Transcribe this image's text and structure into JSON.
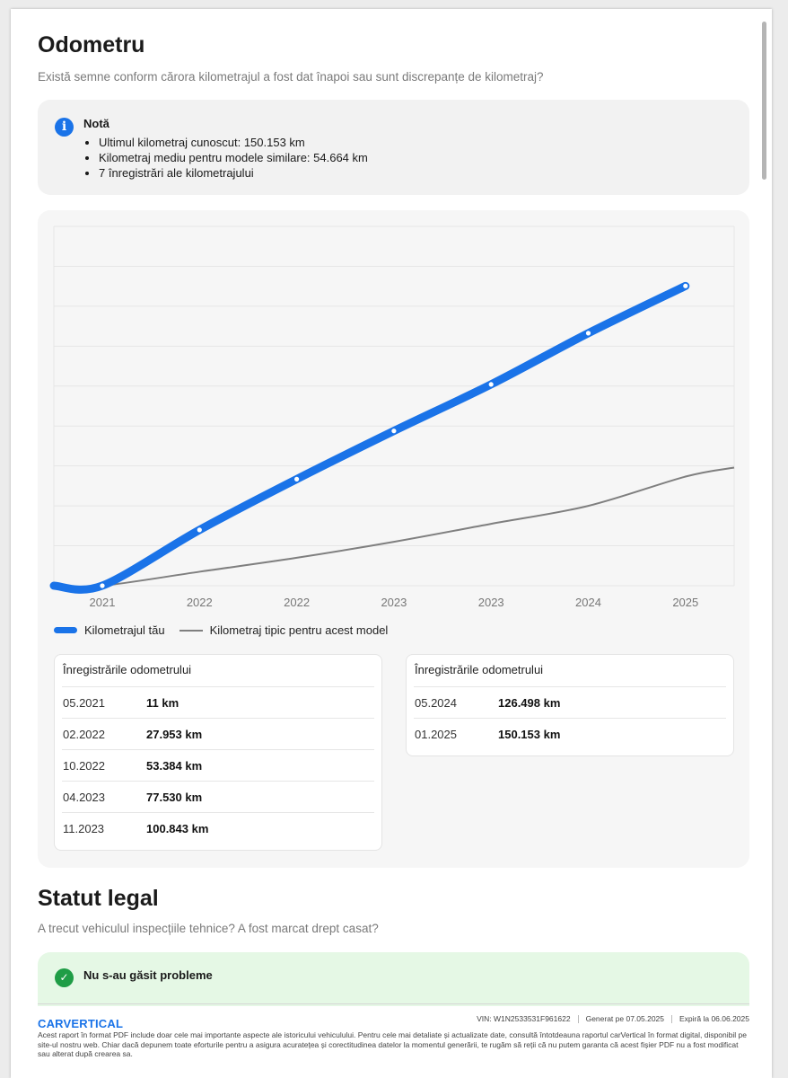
{
  "odometer": {
    "title": "Odometru",
    "subtitle": "Există semne conform cărora kilometrajul a fost dat înapoi sau sunt discrepanțe de kilometraj?",
    "note": {
      "icon": "info-icon",
      "title": "Notă",
      "items": [
        "Ultimul kilometraj cunoscut: 150.153 km",
        "Kilometraj mediu pentru modele similare: 54.664 km",
        "7 înregistrări ale kilometrajului"
      ]
    },
    "legend": {
      "yours": "Kilometrajul tău",
      "typical": "Kilometraj tipic pentru acest model"
    },
    "records_title": "Înregistrările odometrului",
    "records_left": [
      {
        "date": "05.2021",
        "value": "11 km"
      },
      {
        "date": "02.2022",
        "value": "27.953 km"
      },
      {
        "date": "10.2022",
        "value": "53.384 km"
      },
      {
        "date": "04.2023",
        "value": "77.530 km"
      },
      {
        "date": "11.2023",
        "value": "100.843 km"
      }
    ],
    "records_right": [
      {
        "date": "05.2024",
        "value": "126.498 km"
      },
      {
        "date": "01.2025",
        "value": "150.153 km"
      }
    ]
  },
  "chart_data": {
    "type": "line",
    "categories": [
      "2021",
      "2022",
      "2022",
      "2023",
      "2023",
      "2024",
      "2025"
    ],
    "ylim": [
      0,
      180000
    ],
    "grid": true,
    "legend_position": "bottom-left",
    "series": [
      {
        "name": "Kilometrajul tău",
        "color": "#1a73e8",
        "points": [
          {
            "label": "05.2021",
            "value": 11
          },
          {
            "label": "02.2022",
            "value": 27953
          },
          {
            "label": "10.2022",
            "value": 53384
          },
          {
            "label": "04.2023",
            "value": 77530
          },
          {
            "label": "11.2023",
            "value": 100843
          },
          {
            "label": "05.2024",
            "value": 126498
          },
          {
            "label": "01.2025",
            "value": 150153
          }
        ]
      },
      {
        "name": "Kilometraj tipic pentru acest model",
        "color": "#7f7f7f",
        "points": [
          {
            "label": "05.2021",
            "value": 0
          },
          {
            "label": "02.2022",
            "value": 7000
          },
          {
            "label": "10.2022",
            "value": 14000
          },
          {
            "label": "04.2023",
            "value": 22000
          },
          {
            "label": "11.2023",
            "value": 31000
          },
          {
            "label": "05.2024",
            "value": 40000
          },
          {
            "label": "01.2025",
            "value": 54664
          }
        ]
      }
    ]
  },
  "legal": {
    "title": "Statut legal",
    "subtitle": "A trecut vehiculul inspecțiile tehnice? A fost marcat drept casat?",
    "status": "Nu s-au găsit probleme",
    "status_icon": "check-circle-icon"
  },
  "footer": {
    "brand": "CARVERTICAL",
    "vin": "VIN:  W1N2533531F961622",
    "generated": "Generat pe  07.05.2025",
    "expires": "Expiră la  06.06.2025",
    "disclaimer": "Acest raport în format PDF include doar cele mai importante aspecte ale istoricului vehiculului. Pentru cele mai detaliate și actualizate date, consultă întotdeauna raportul carVertical în format digital, disponibil pe site-ul nostru web. Chiar dacă depunem toate eforturile pentru a asigura acuratețea și corectitudinea datelor la momentul generării, te rugăm să reții că nu putem garanta că acest fișier PDF nu a fost modificat sau alterat după crearea sa."
  }
}
